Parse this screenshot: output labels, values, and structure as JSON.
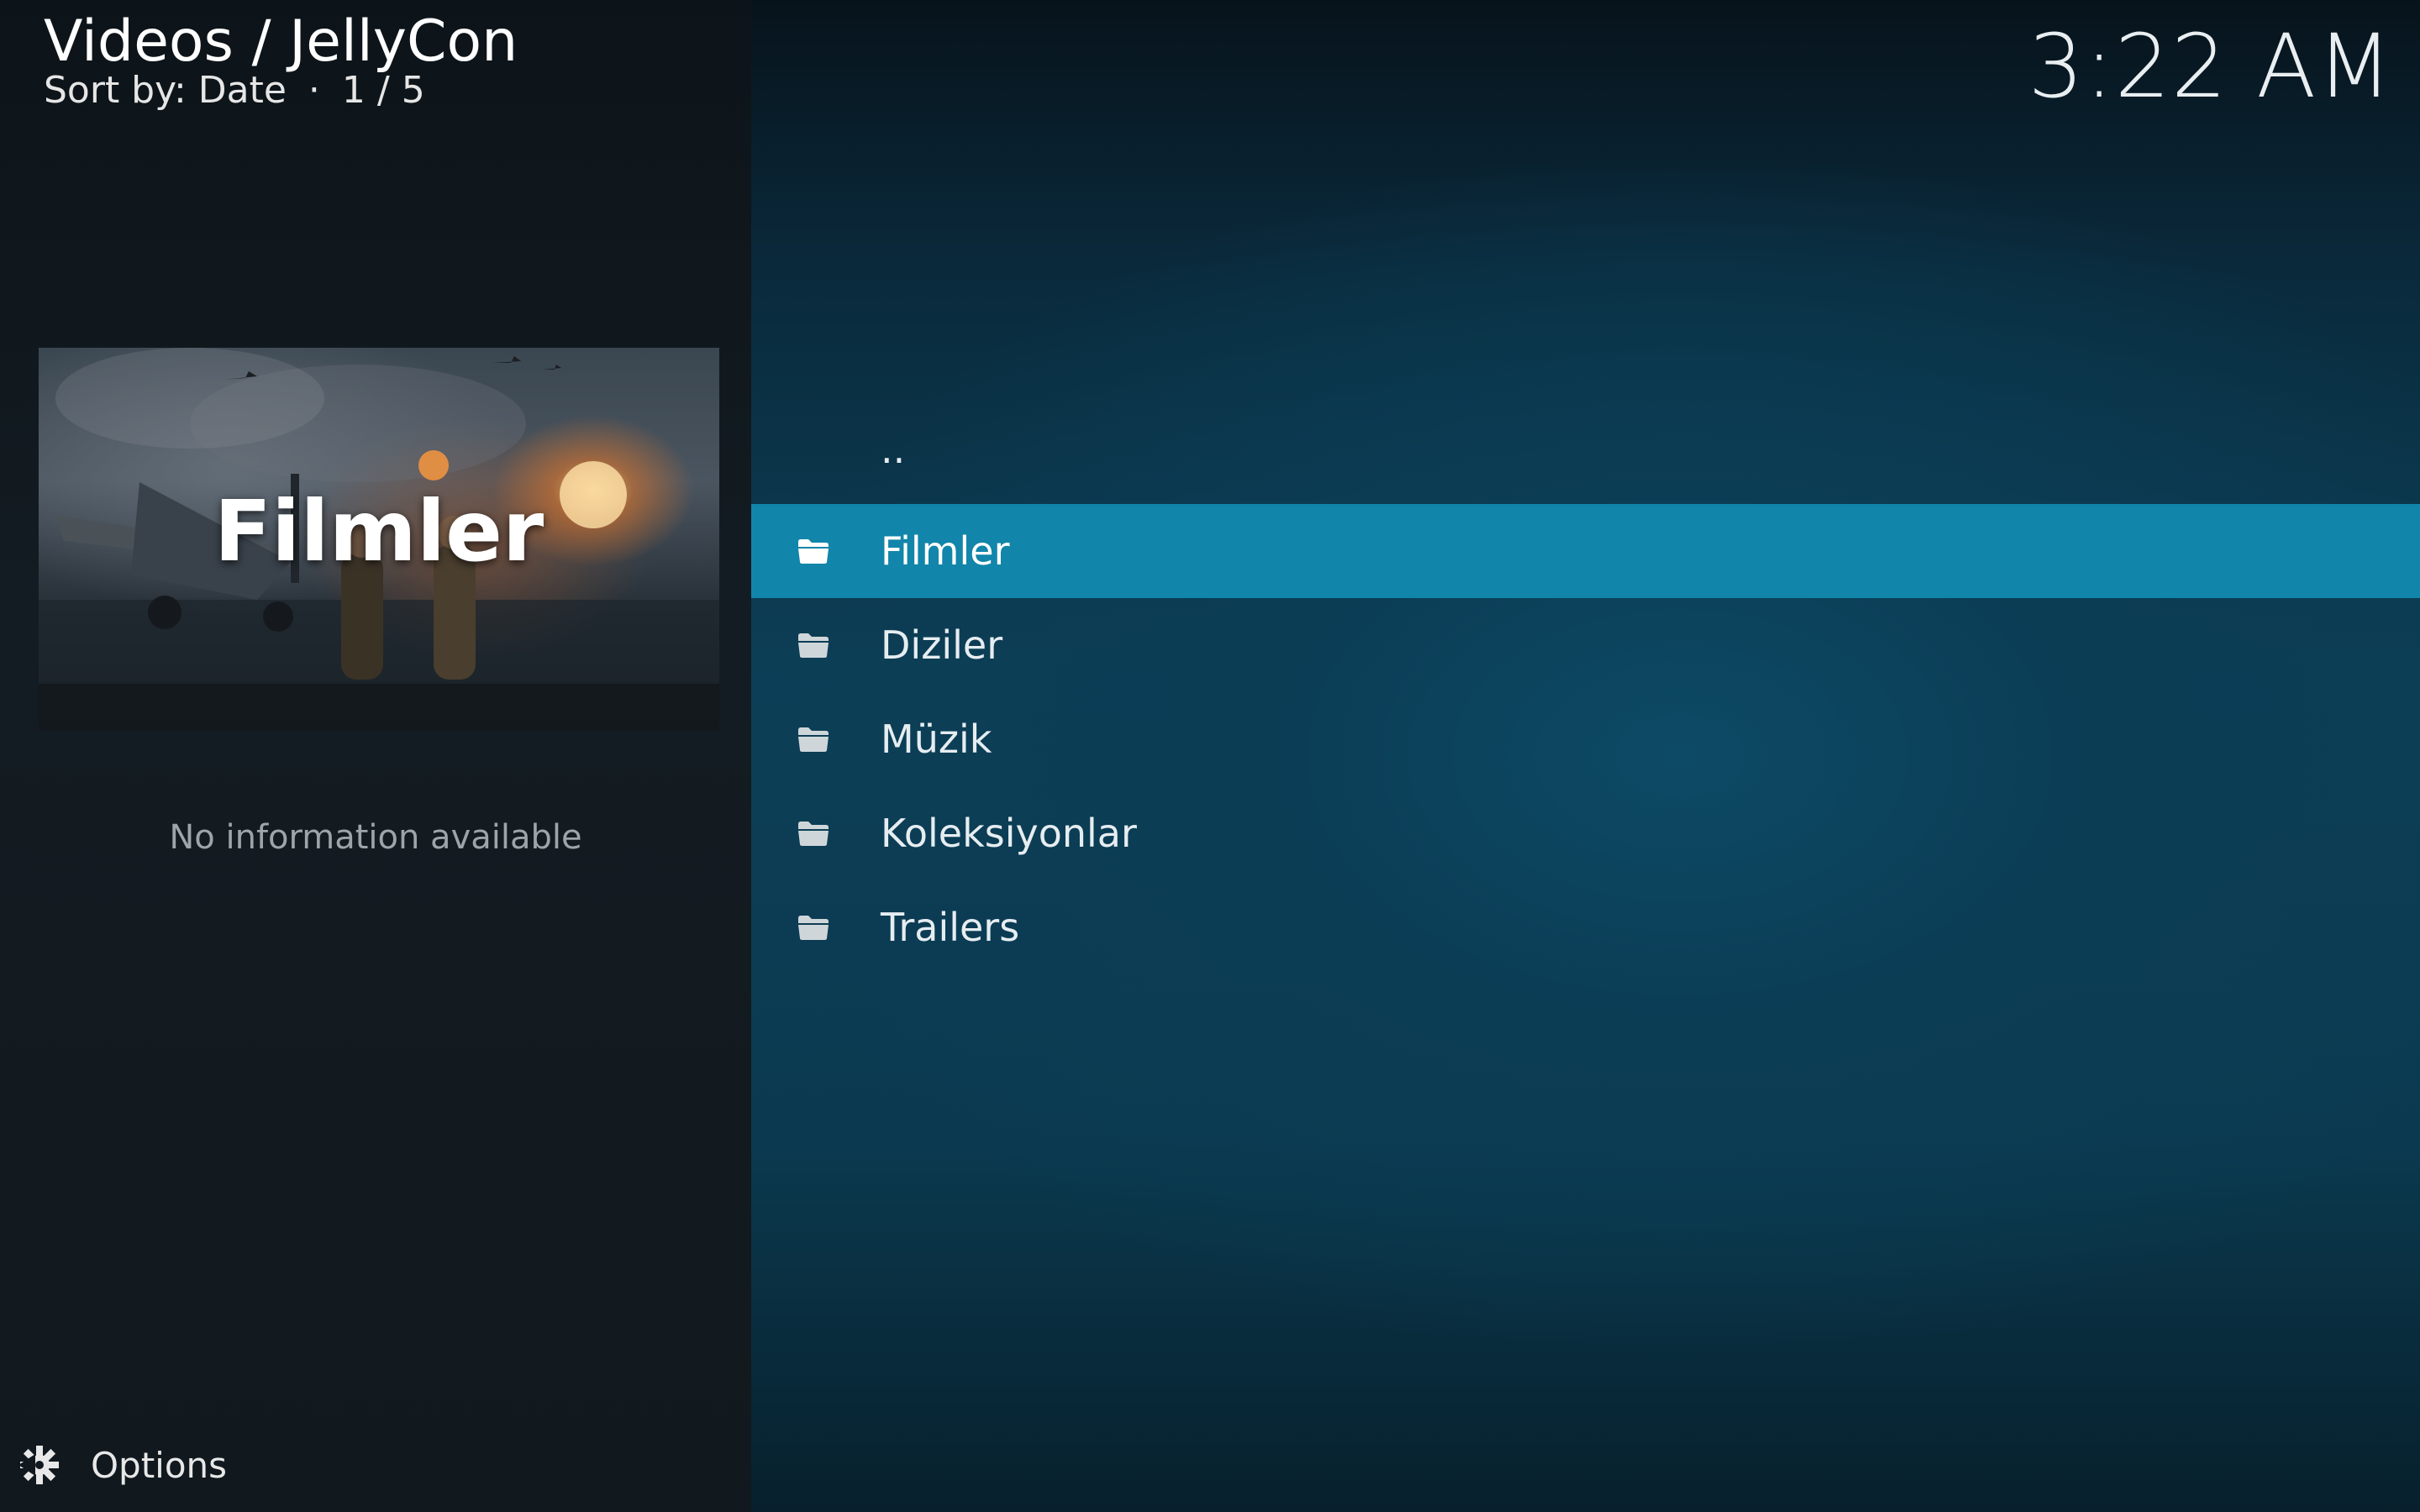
{
  "header": {
    "title": "Videos / JellyCon",
    "sort_label": "Sort by: Date",
    "separator": "·",
    "position": "1 / 5"
  },
  "clock": {
    "time": "3:22 AM"
  },
  "poster": {
    "title": "Filmler"
  },
  "info": {
    "text": "No information available"
  },
  "options": {
    "label": "Options",
    "icon": "options-gear-icon"
  },
  "list": {
    "parent_label": "..",
    "items": [
      {
        "label": "Filmler",
        "icon": "folder-icon",
        "selected": true
      },
      {
        "label": "Diziler",
        "icon": "folder-icon",
        "selected": false
      },
      {
        "label": "Müzik",
        "icon": "folder-icon",
        "selected": false
      },
      {
        "label": "Koleksiyonlar",
        "icon": "folder-icon",
        "selected": false
      },
      {
        "label": "Trailers",
        "icon": "folder-icon",
        "selected": false
      }
    ]
  },
  "colors": {
    "selection": "#1185aa",
    "left_panel": "#12191e",
    "background": "#0b3d55"
  }
}
